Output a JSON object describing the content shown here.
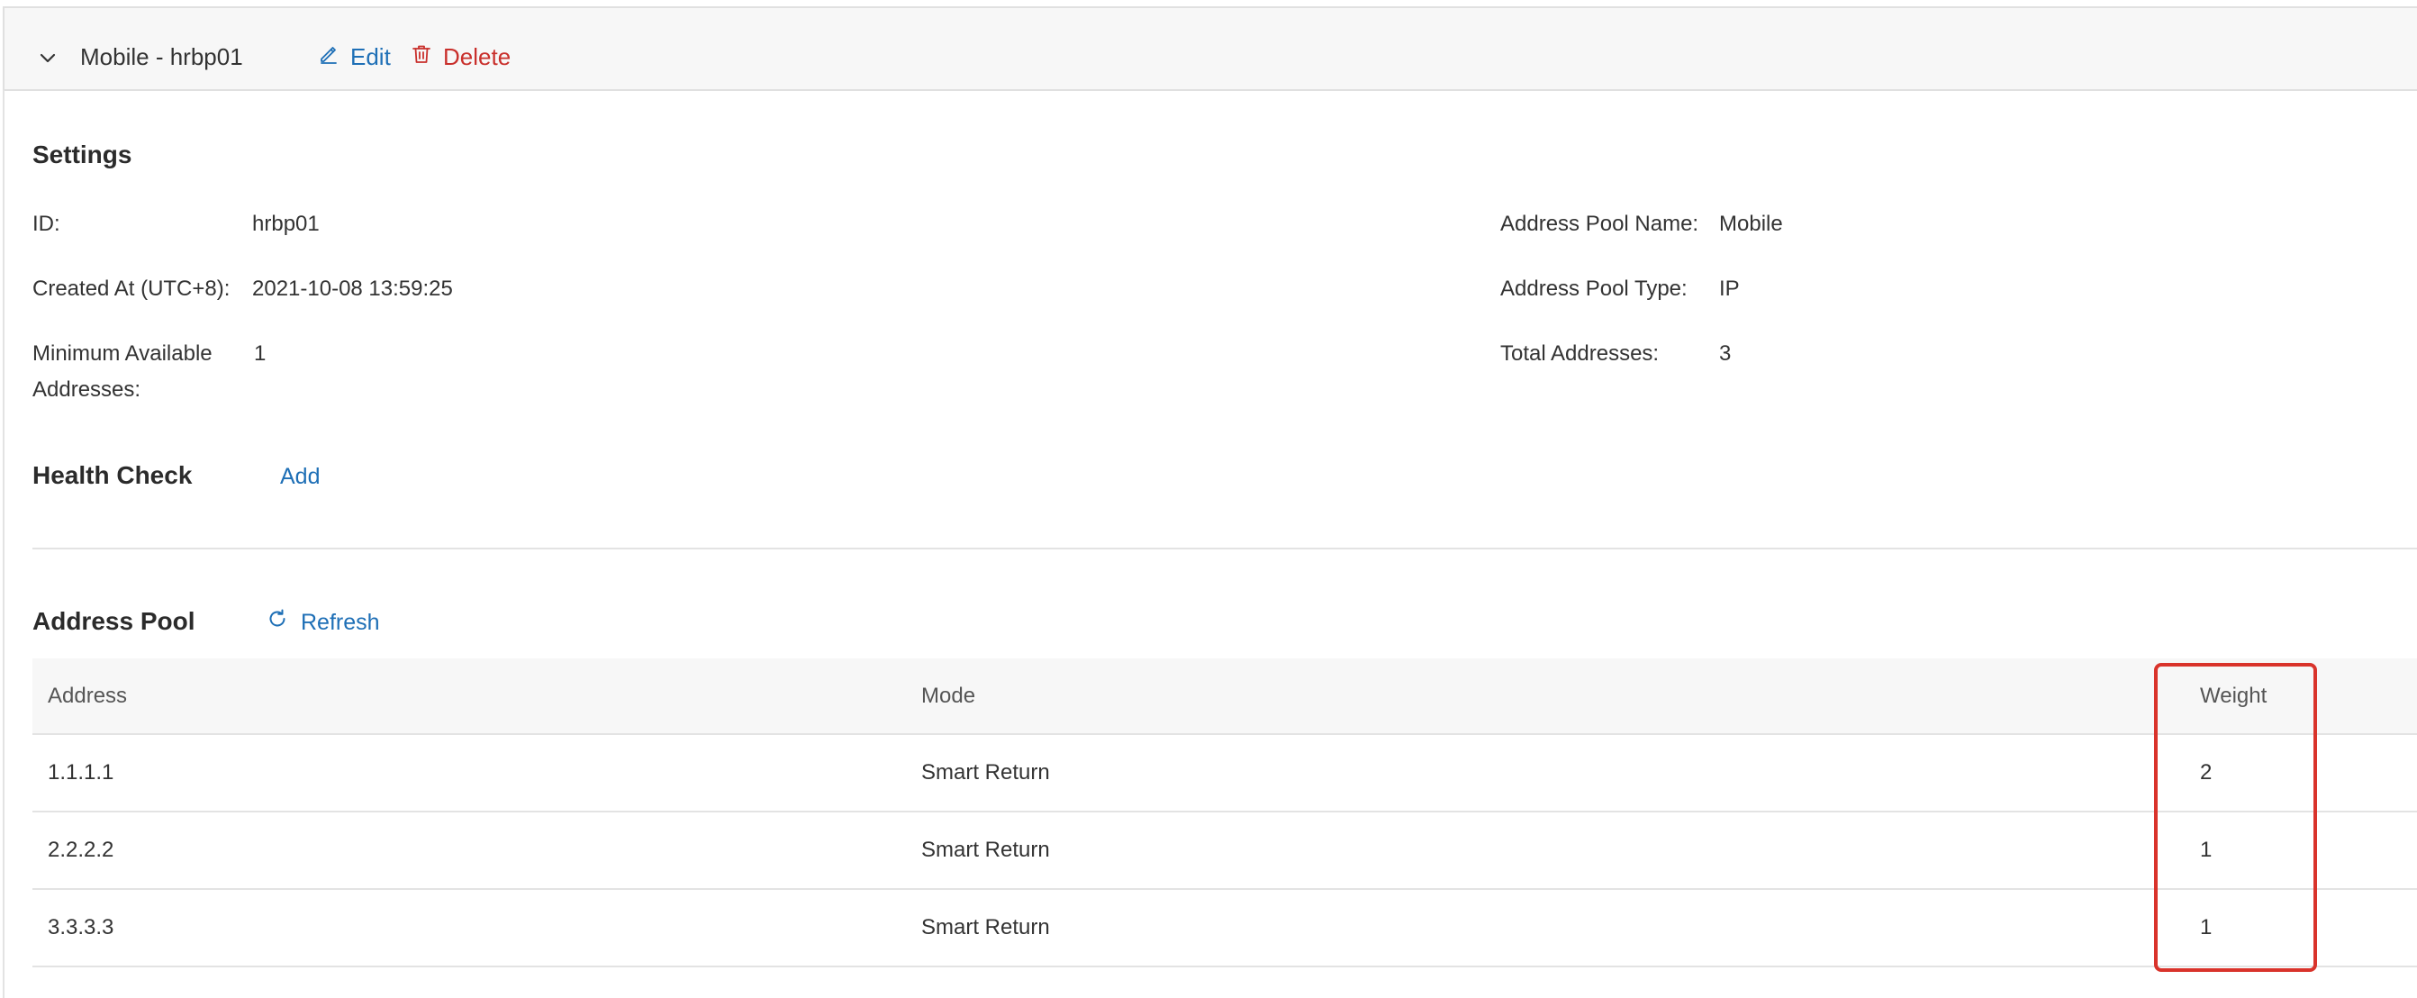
{
  "header": {
    "title": "Mobile - hrbp01",
    "edit_label": "Edit",
    "delete_label": "Delete"
  },
  "settings": {
    "title": "Settings",
    "id_label": "ID:",
    "id_value": "hrbp01",
    "created_label": "Created At (UTC+8):",
    "created_value": "2021-10-08 13:59:25",
    "min_label_line1": "Minimum Available",
    "min_label_line2": "Addresses:",
    "min_value": "1",
    "pool_name_label": "Address Pool Name:",
    "pool_name_value": "Mobile",
    "pool_type_label": "Address Pool Type:",
    "pool_type_value": "IP",
    "total_label": "Total Addresses:",
    "total_value": "3"
  },
  "health_check": {
    "title": "Health Check",
    "add_label": "Add"
  },
  "address_pool": {
    "title": "Address Pool",
    "refresh_label": "Refresh",
    "columns": [
      "Address",
      "Mode",
      "Weight"
    ],
    "rows": [
      [
        "1.1.1.1",
        "Smart Return",
        "2"
      ],
      [
        "2.2.2.2",
        "Smart Return",
        "1"
      ],
      [
        "3.3.3.3",
        "Smart Return",
        "1"
      ]
    ]
  },
  "colors": {
    "link": "#1e6fb6",
    "danger": "#c9302c",
    "highlight": "#d9332b"
  },
  "icons": {
    "collapse": "chevron-down-icon",
    "edit": "edit-pencil-icon",
    "delete": "trash-icon",
    "refresh": "refresh-icon"
  }
}
